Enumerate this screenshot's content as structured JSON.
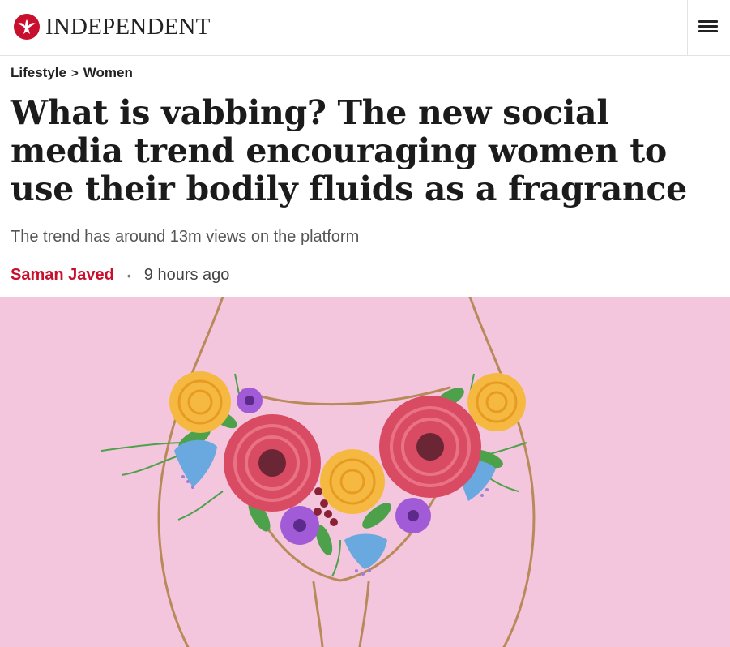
{
  "header": {
    "brand": "INDEPENDENT",
    "logo_icon": "eagle-logo-icon",
    "menu_icon": "hamburger-menu-icon"
  },
  "breadcrumb": {
    "section": "Lifestyle",
    "separator": ">",
    "subsection": "Women"
  },
  "article": {
    "headline": "What is vabbing? The new social media trend encouraging women to use their bodily fluids as a fragrance",
    "standfirst": "The trend has around 13m views on the platform",
    "author": "Saman Javed",
    "separator": "•",
    "published": "9 hours ago"
  },
  "colors": {
    "brand_red": "#c8102e",
    "hero_background": "#f4c6dd"
  }
}
